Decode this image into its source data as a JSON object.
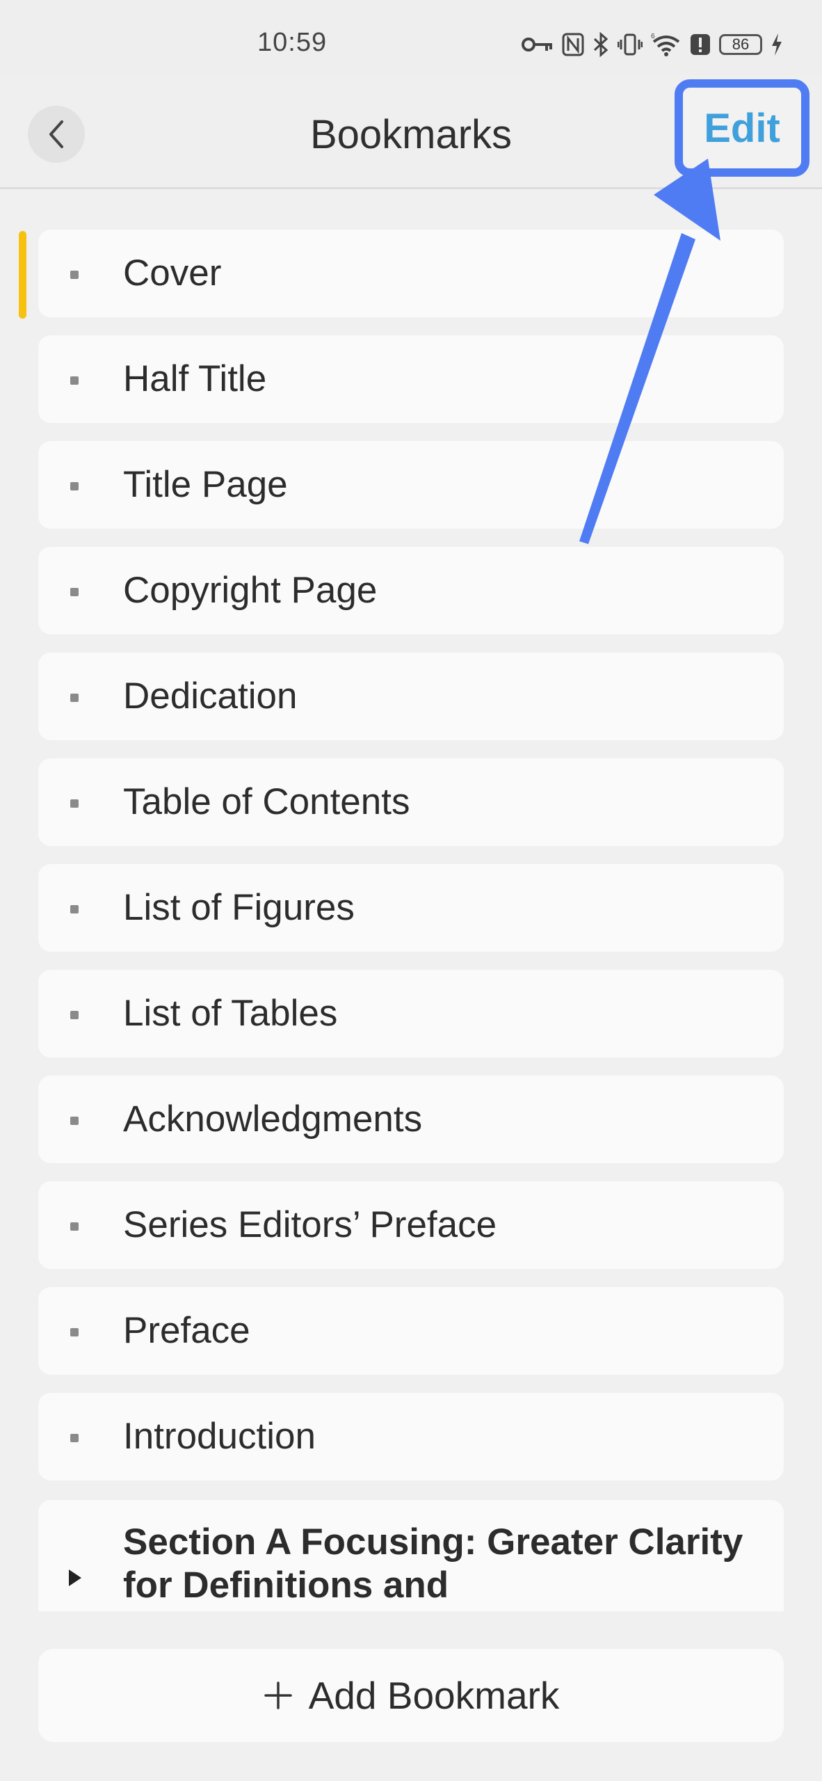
{
  "status_bar": {
    "time": "10:59",
    "battery": "86",
    "icons": [
      "key-icon",
      "nfc-icon",
      "bluetooth-icon",
      "vibrate-icon",
      "signal-icon",
      "wifi-icon",
      "alert-icon",
      "battery-icon",
      "charging-icon"
    ]
  },
  "header": {
    "title": "Bookmarks",
    "edit_label": "Edit",
    "back_icon": "chevron-left-icon"
  },
  "bookmarks": {
    "items": [
      {
        "label": "Cover",
        "current": true
      },
      {
        "label": "Half Title"
      },
      {
        "label": "Title Page"
      },
      {
        "label": "Copyright Page"
      },
      {
        "label": "Dedication"
      },
      {
        "label": "Table of Contents"
      },
      {
        "label": "List of Figures"
      },
      {
        "label": "List of Tables"
      },
      {
        "label": "Acknowledgments"
      },
      {
        "label": "Series Editors’ Preface"
      },
      {
        "label": "Preface"
      },
      {
        "label": "Introduction"
      }
    ],
    "section": {
      "label": "Section A Focusing: Greater Clarity for Definitions and"
    }
  },
  "footer": {
    "add_label": "Add Bookmark",
    "add_icon": "plus-icon"
  },
  "colors": {
    "accent_edit": "#3fa0dc",
    "annotation": "#4f7cf2",
    "current_marker": "#f6c20f"
  }
}
